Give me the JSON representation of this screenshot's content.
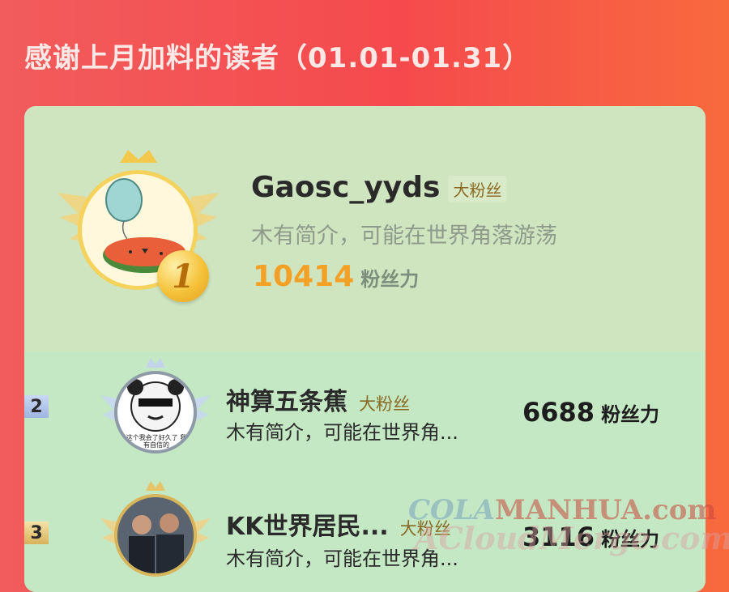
{
  "header": {
    "title": "感谢上月加料的读者（01.01-01.31）"
  },
  "top_reader": {
    "rank": "1",
    "name": "Gaosc_yyds",
    "tag": "大粉丝",
    "bio": "木有简介，可能在世界角落游荡",
    "score": "10414",
    "score_unit": "粉丝力"
  },
  "readers": [
    {
      "rank": "2",
      "name": "神算五条蕉",
      "tag": "大粉丝",
      "bio": "木有简介，可能在世界角...",
      "score": "6688",
      "score_unit": "粉丝力",
      "avatar_caption": "这个我会了好久了 我有自信的"
    },
    {
      "rank": "3",
      "name": "KK世界居民...",
      "tag": "大粉丝",
      "bio": "木有简介，可能在世界角...",
      "score": "3116",
      "score_unit": "粉丝力"
    }
  ],
  "watermark": {
    "line1_a": "COLA",
    "line1_b": "MANHUA.com",
    "line2": "ACloudMerge.com"
  },
  "colors": {
    "accent": "#f2a126",
    "background": "#f25c5c",
    "card": "#cfe5c0"
  }
}
